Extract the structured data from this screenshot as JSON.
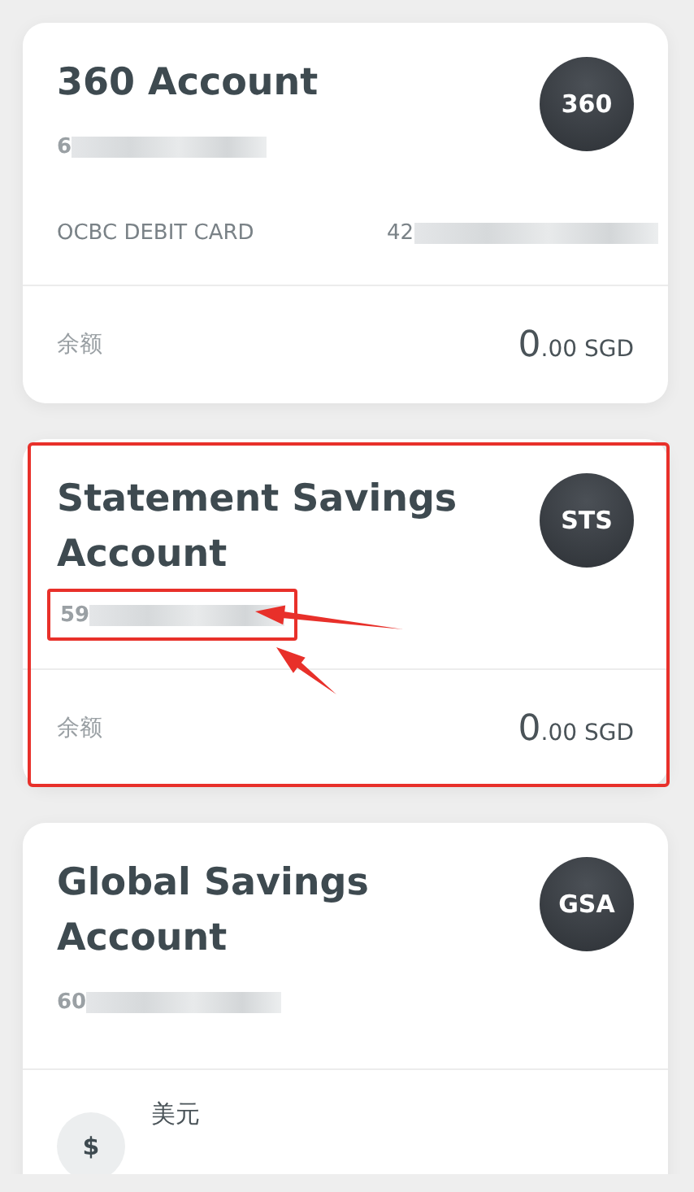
{
  "accounts": [
    {
      "name": "360 Account",
      "badge": "360",
      "number": "6",
      "highlighted": false,
      "number_highlighted": false,
      "linked_card": {
        "label": "OCBC DEBIT CARD",
        "number": "42"
      },
      "balance": {
        "label": "余额",
        "whole": "0",
        "decimals": ".00",
        "currency": "SGD"
      }
    },
    {
      "name": "Statement Savings Account",
      "badge": "STS",
      "number": "59",
      "highlighted": true,
      "number_highlighted": true,
      "balance": {
        "label": "余额",
        "whole": "0",
        "decimals": ".00",
        "currency": "SGD"
      }
    },
    {
      "name": "Global Savings Account",
      "badge": "GSA",
      "number": "60",
      "highlighted": false,
      "number_highlighted": false,
      "currencies": [
        {
          "symbol": "$",
          "name": "美元"
        }
      ]
    }
  ]
}
